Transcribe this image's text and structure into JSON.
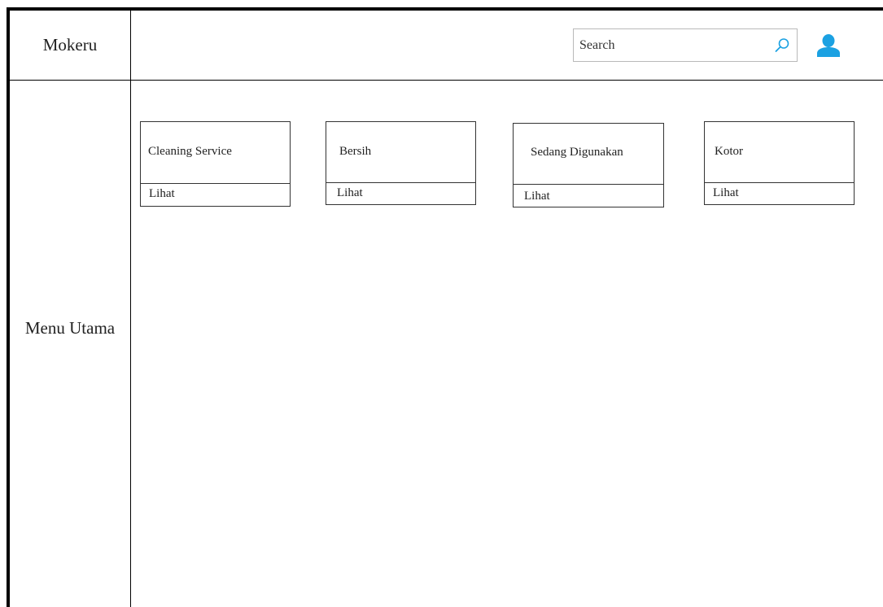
{
  "brand": {
    "name": "Mokeru"
  },
  "sidebar": {
    "menu_label": "Menu Utama"
  },
  "header": {
    "search": {
      "placeholder": "Search",
      "value": "",
      "icon": "search-icon"
    },
    "avatar": {
      "icon": "user-icon",
      "color": "#1ba1e2"
    }
  },
  "cards": [
    {
      "title": "Cleaning Service",
      "link_label": "Lihat"
    },
    {
      "title": "Bersih",
      "link_label": "Lihat"
    },
    {
      "title": "Sedang Digunakan",
      "link_label": "Lihat"
    },
    {
      "title": "Kotor",
      "link_label": "Lihat"
    }
  ]
}
